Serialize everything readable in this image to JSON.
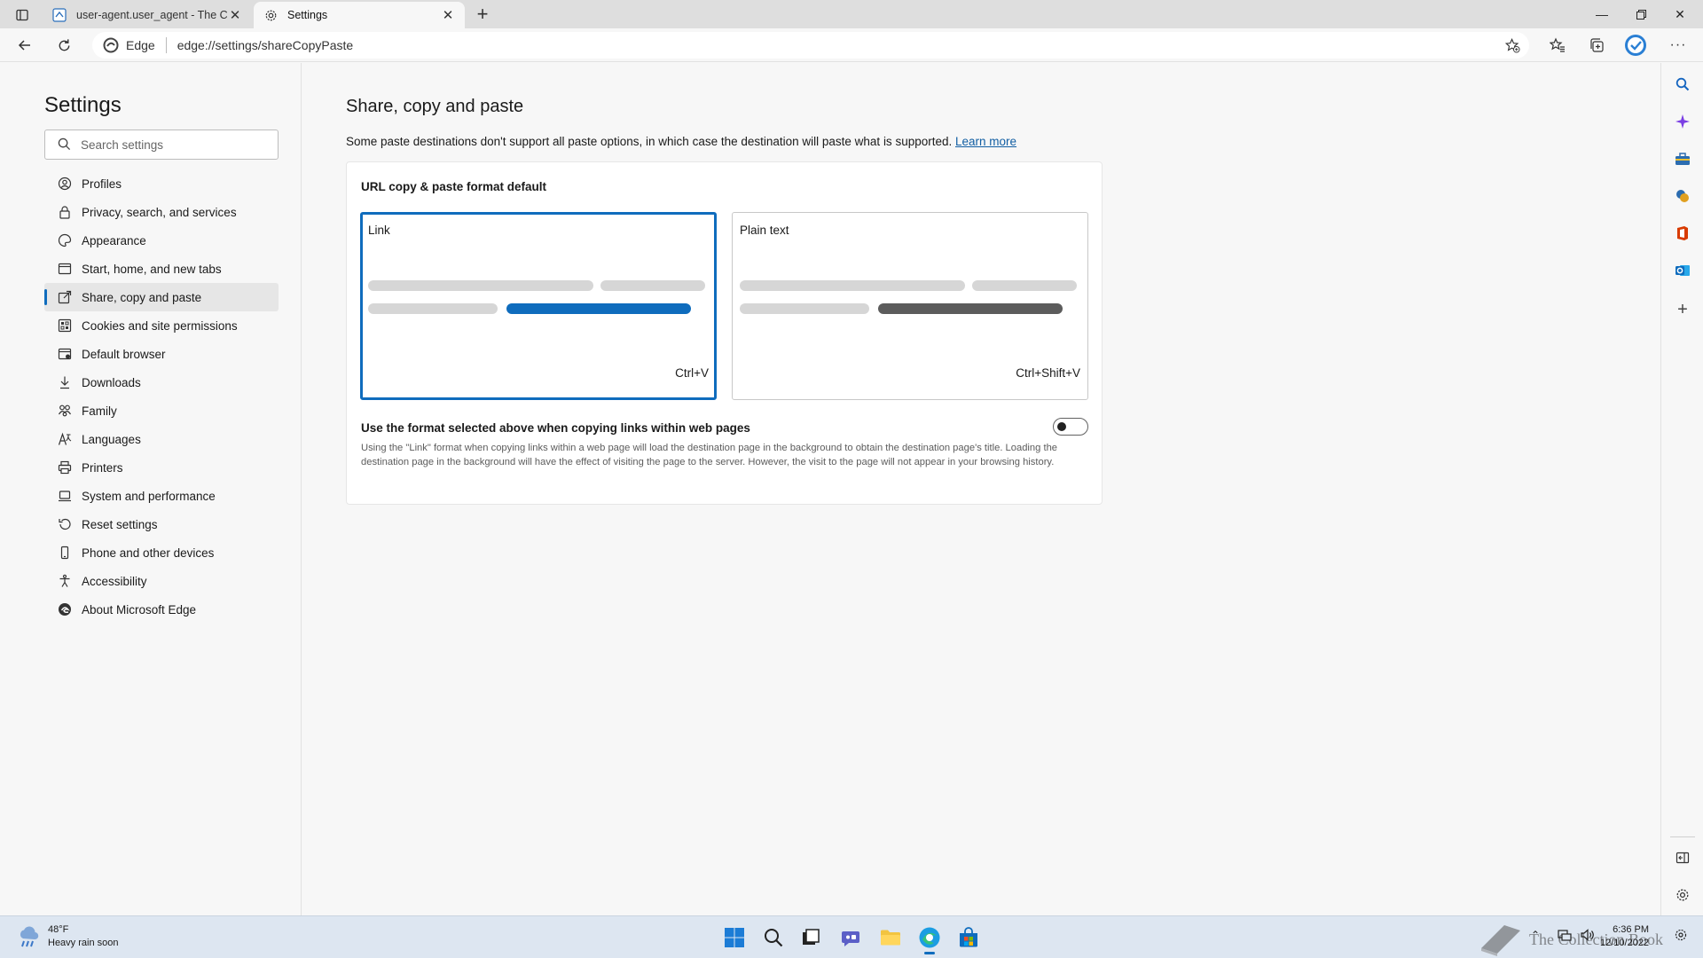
{
  "browser": {
    "tabs": [
      {
        "title": "user-agent.user_agent - The Coll",
        "active": false
      },
      {
        "title": "Settings",
        "active": true
      }
    ],
    "omnibox": {
      "scheme_label": "Edge",
      "url": "edge://settings/shareCopyPaste"
    }
  },
  "settings_nav": {
    "title": "Settings",
    "search_placeholder": "Search settings",
    "items": [
      {
        "label": "Profiles",
        "icon": "profile-icon"
      },
      {
        "label": "Privacy, search, and services",
        "icon": "lock-icon"
      },
      {
        "label": "Appearance",
        "icon": "palette-icon"
      },
      {
        "label": "Start, home, and new tabs",
        "icon": "home-tabs-icon"
      },
      {
        "label": "Share, copy and paste",
        "icon": "share-icon",
        "selected": true
      },
      {
        "label": "Cookies and site permissions",
        "icon": "cookie-icon"
      },
      {
        "label": "Default browser",
        "icon": "browser-icon"
      },
      {
        "label": "Downloads",
        "icon": "download-icon"
      },
      {
        "label": "Family",
        "icon": "family-icon"
      },
      {
        "label": "Languages",
        "icon": "language-icon"
      },
      {
        "label": "Printers",
        "icon": "printer-icon"
      },
      {
        "label": "System and performance",
        "icon": "laptop-icon"
      },
      {
        "label": "Reset settings",
        "icon": "reset-icon"
      },
      {
        "label": "Phone and other devices",
        "icon": "phone-icon"
      },
      {
        "label": "Accessibility",
        "icon": "accessibility-icon"
      },
      {
        "label": "About Microsoft Edge",
        "icon": "edge-logo-icon"
      }
    ]
  },
  "main": {
    "title": "Share, copy and paste",
    "description": "Some paste destinations don't support all paste options, in which case the destination will paste what is supported.",
    "learn_more": "Learn more",
    "card": {
      "title": "URL copy & paste format default",
      "options": [
        {
          "label": "Link",
          "shortcut": "Ctrl+V",
          "selected": true,
          "highlight_color": "#0f6cbd"
        },
        {
          "label": "Plain text",
          "shortcut": "Ctrl+Shift+V",
          "selected": false,
          "highlight_color": "#5c5c5c"
        }
      ],
      "toggle_label": "Use the format selected above when copying links within web pages",
      "toggle_on": false,
      "help_text": "Using the \"Link\" format when copying links within a web page will load the destination page in the background to obtain the destination page's title. Loading the destination page in the background will have the effect of visiting the page to the server. However, the visit to the page will not appear in your browsing history."
    }
  },
  "taskbar": {
    "weather_temp": "48°F",
    "weather_desc": "Heavy rain soon",
    "time": "6:36 PM",
    "date": "12/10/2022",
    "watermark": "The Collection Book"
  },
  "colors": {
    "accent": "#0f6cbd",
    "link": "#115ea3"
  }
}
